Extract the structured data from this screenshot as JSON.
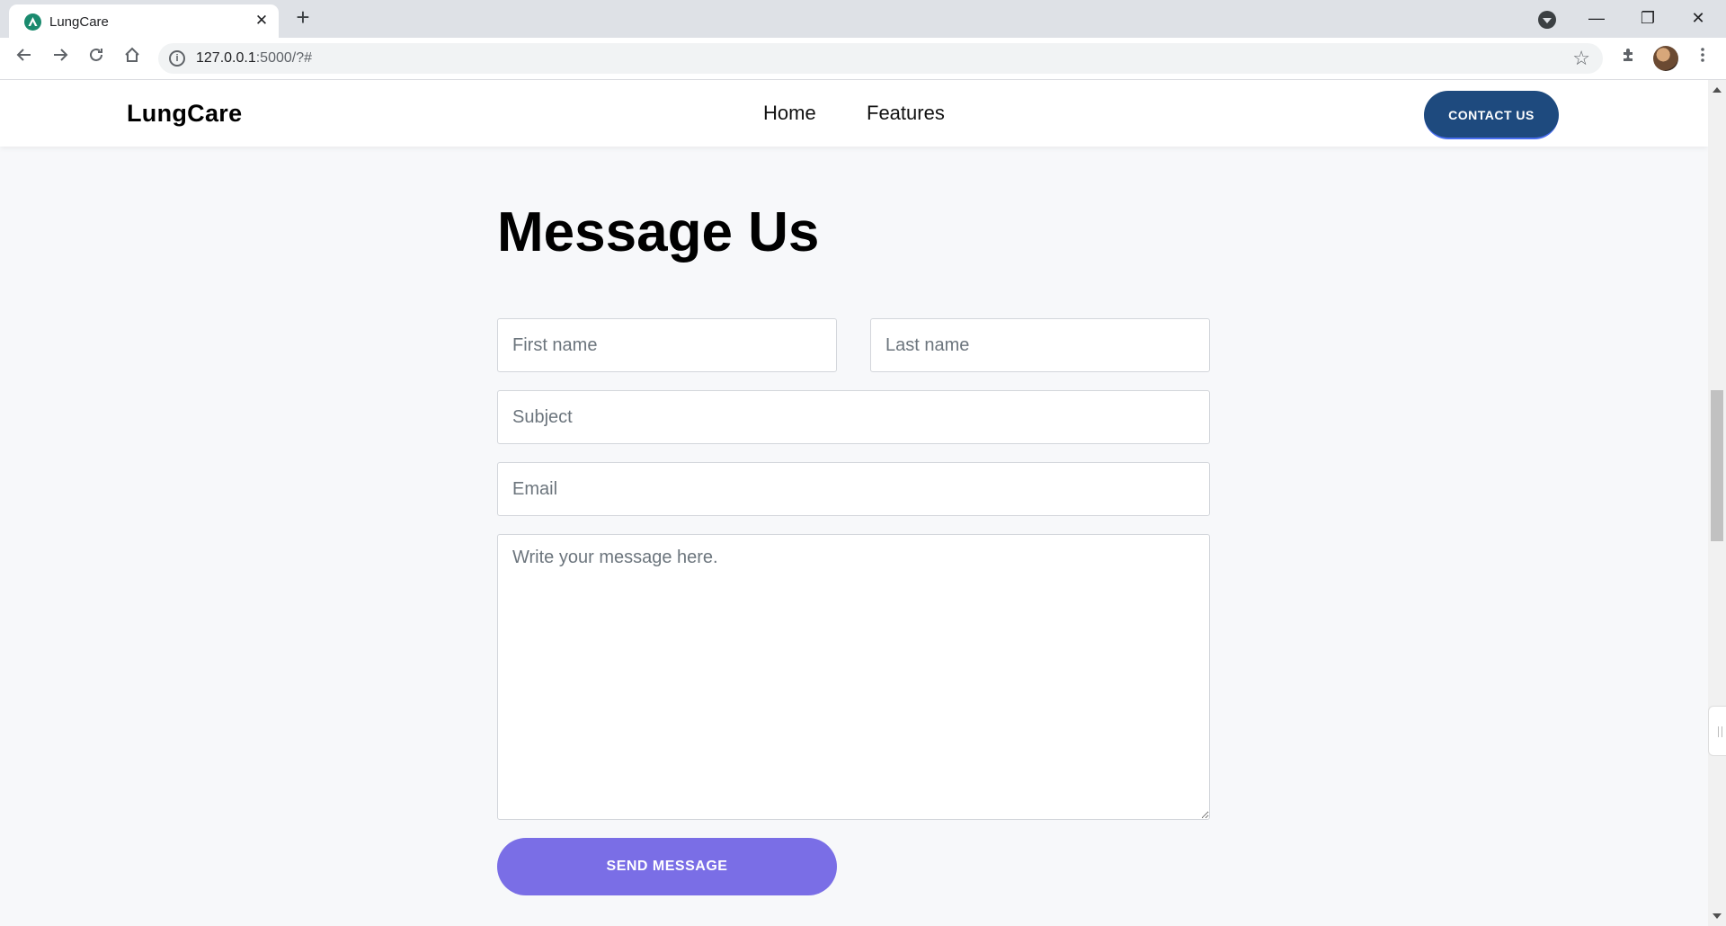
{
  "browser": {
    "tab_title": "LungCare",
    "tab_close": "✕",
    "new_tab": "+",
    "url_host": "127.0.0.1",
    "url_rest": ":5000/?#",
    "minimize": "—",
    "restore": "❐",
    "close": "✕"
  },
  "nav": {
    "brand": "LungCare",
    "links": [
      "Home",
      "Features"
    ],
    "contact_label": "CONTACT US"
  },
  "form": {
    "heading": "Message Us",
    "first_name_placeholder": "First name",
    "last_name_placeholder": "Last name",
    "subject_placeholder": "Subject",
    "email_placeholder": "Email",
    "message_placeholder": "Write your message here.",
    "submit_label": "SEND MESSAGE"
  },
  "colors": {
    "contact_button": "#1e4a7e",
    "send_button": "#7a6ee6",
    "favicon": "#1a8a6e"
  }
}
